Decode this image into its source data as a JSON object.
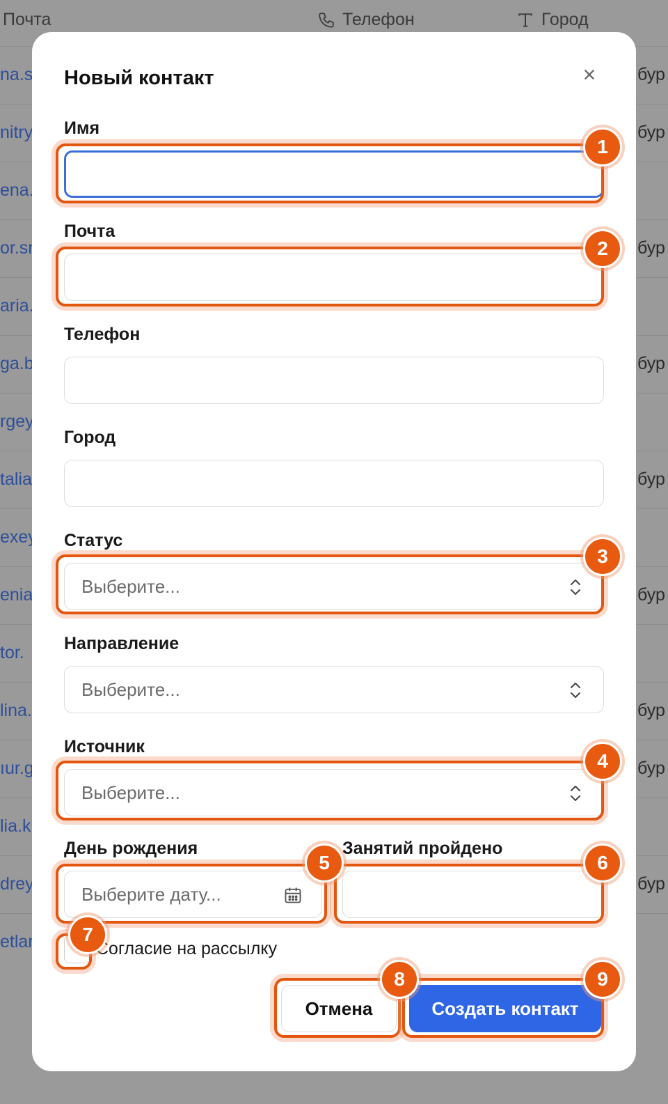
{
  "background": {
    "columns": {
      "email": "Почта",
      "phone": "Телефон",
      "city": "Город"
    },
    "rows": [
      {
        "email": "na.s",
        "city": "бур"
      },
      {
        "email": "nitry",
        "city": "бур"
      },
      {
        "email": "ena.l",
        "city": ""
      },
      {
        "email": "or.sn",
        "city": "бур"
      },
      {
        "email": "aria.",
        "city": ""
      },
      {
        "email": "ga.b",
        "city": "бур"
      },
      {
        "email": "rgey",
        "city": ""
      },
      {
        "email": "talia",
        "city": "бур"
      },
      {
        "email": "exey",
        "city": ""
      },
      {
        "email": "enia",
        "city": "бур"
      },
      {
        "email": "tor.",
        "city": ""
      },
      {
        "email": "lina.",
        "city": "бур"
      },
      {
        "email": "ıur.g",
        "city": "бур"
      },
      {
        "email": "lia.k",
        "city": ""
      },
      {
        "email": "drey",
        "city": "бур"
      },
      {
        "email": "etlar",
        "city": ""
      }
    ]
  },
  "modal": {
    "title": "Новый контакт",
    "close_icon": "×",
    "fields": {
      "name_label": "Имя",
      "email_label": "Почта",
      "phone_label": "Телефон",
      "city_label": "Город",
      "status_label": "Статус",
      "status_placeholder": "Выберите...",
      "direction_label": "Направление",
      "direction_placeholder": "Выберите...",
      "source_label": "Источник",
      "source_placeholder": "Выберите...",
      "birthday_label": "День рождения",
      "birthday_placeholder": "Выберите дату...",
      "lessons_label": "Занятий пройдено"
    },
    "consent_label": "Согласие на рассылку",
    "cancel_label": "Отмена",
    "create_label": "Создать контакт"
  },
  "annotations": [
    "1",
    "2",
    "3",
    "4",
    "5",
    "6",
    "7",
    "8",
    "9"
  ],
  "colors": {
    "accent": "#2f66e6",
    "annotation": "#e85a10",
    "focus": "#3b6fd8"
  }
}
